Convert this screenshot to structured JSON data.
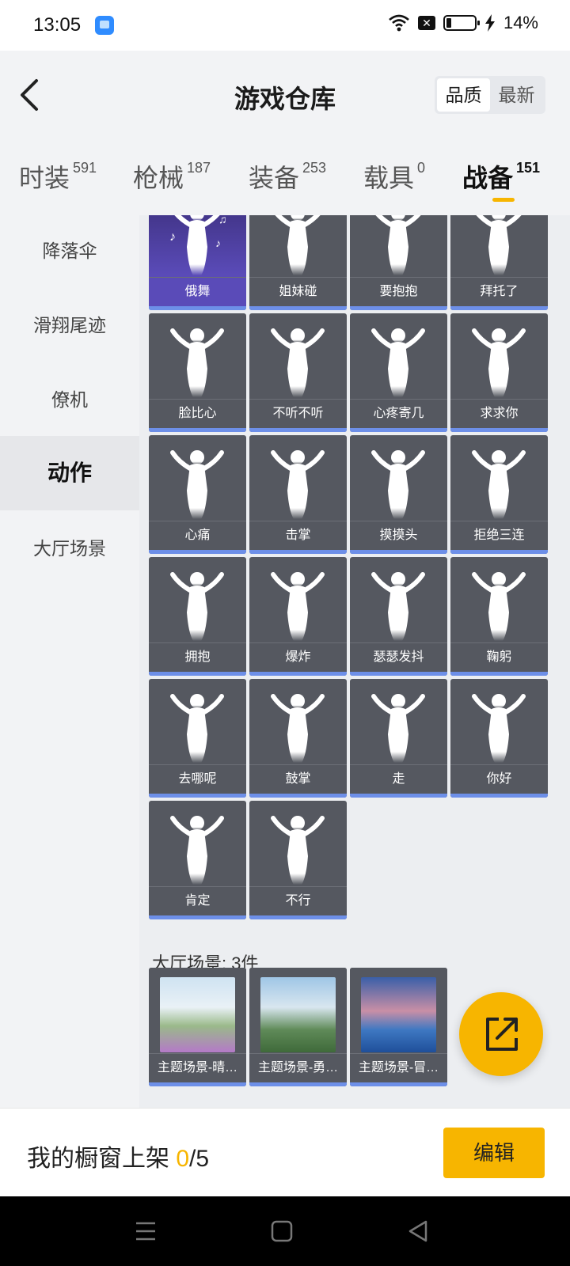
{
  "status_bar": {
    "time": "13:05",
    "battery_pct": "14%",
    "battery_level": 0.14,
    "icons": [
      "app-icon",
      "wifi-icon",
      "no-sim-icon",
      "battery-icon",
      "charging-icon"
    ]
  },
  "header": {
    "title": "游戏仓库",
    "back_icon": "back-arrow-icon",
    "sort_options": [
      "品质",
      "最新"
    ],
    "sort_selected": "品质"
  },
  "tabs": [
    {
      "label": "时装",
      "count": "591"
    },
    {
      "label": "枪械",
      "count": "187"
    },
    {
      "label": "装备",
      "count": "253"
    },
    {
      "label": "载具",
      "count": "0"
    },
    {
      "label": "战备",
      "count": "151",
      "active": true
    }
  ],
  "sidebar": {
    "items": [
      {
        "label": "降落伞"
      },
      {
        "label": "滑翔尾迹"
      },
      {
        "label": "僚机"
      },
      {
        "label": "动作",
        "active": true
      },
      {
        "label": "大厅场景"
      }
    ]
  },
  "actions": {
    "items": [
      {
        "name": "俄舞",
        "icon": "dance-pose-icon"
      },
      {
        "name": "姐妹碰",
        "icon": "hip-bump-pose-icon"
      },
      {
        "name": "要抱抱",
        "icon": "open-arms-pose-icon"
      },
      {
        "name": "拜托了",
        "icon": "praying-hands-pose-icon"
      },
      {
        "name": "脸比心",
        "icon": "heart-hands-pose-icon"
      },
      {
        "name": "不听不听",
        "icon": "covering-ears-pose-icon"
      },
      {
        "name": "心疼寄几",
        "icon": "self-hug-pose-icon"
      },
      {
        "name": "求求你",
        "icon": "begging-pose-icon"
      },
      {
        "name": "心痛",
        "icon": "heartache-pose-icon"
      },
      {
        "name": "击掌",
        "icon": "high-five-pose-icon"
      },
      {
        "name": "摸摸头",
        "icon": "head-pat-pose-icon"
      },
      {
        "name": "拒绝三连",
        "icon": "crossed-arms-pose-icon"
      },
      {
        "name": "拥抱",
        "icon": "hug-pose-icon"
      },
      {
        "name": "爆炸",
        "icon": "explosion-pose-icon"
      },
      {
        "name": "瑟瑟发抖",
        "icon": "shivering-pose-icon"
      },
      {
        "name": "鞠躬",
        "icon": "bow-pose-icon"
      },
      {
        "name": "去哪呢",
        "icon": "where-to-pose-icon"
      },
      {
        "name": "鼓掌",
        "icon": "clapping-hands-icon"
      },
      {
        "name": "走",
        "icon": "pointing-hand-icon"
      },
      {
        "name": "你好",
        "icon": "waving-hand-icon"
      },
      {
        "name": "肯定",
        "icon": "nodding-head-icon"
      },
      {
        "name": "不行",
        "icon": "shaking-head-icon"
      }
    ]
  },
  "scenes": {
    "section_title": "大厅场景: 3件",
    "items": [
      {
        "name": "主题场景-晴…",
        "icon": "meadow-scene-thumbnail"
      },
      {
        "name": "主题场景-勇…",
        "icon": "mountain-scene-thumbnail"
      },
      {
        "name": "主题场景-冒…",
        "icon": "sunset-sea-scene-thumbnail"
      }
    ]
  },
  "share_button": {
    "icon": "share-external-icon"
  },
  "bottom_bar": {
    "label": "我的橱窗上架 ",
    "count_current": "0",
    "count_total": "/5",
    "edit_label": "编辑"
  },
  "nav_bar": {
    "icons": [
      "menu-icon",
      "home-square-icon",
      "back-triangle-icon"
    ]
  },
  "colors": {
    "accent": "#f7b500",
    "rarity_blue": "#6d8fe8",
    "card_bg": "#555860",
    "featured_purple": "#4a3b9a"
  }
}
